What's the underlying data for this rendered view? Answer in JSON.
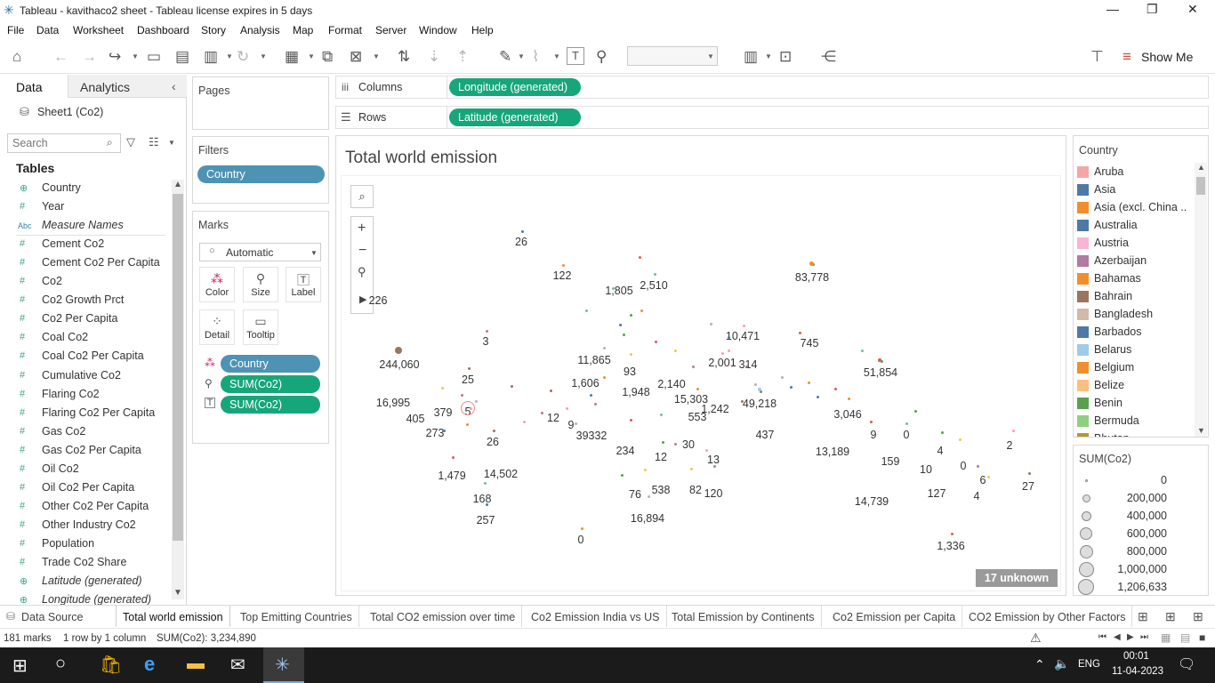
{
  "window": {
    "title": "Tableau - kavithaco2 sheet - Tableau license expires in 5 days"
  },
  "menu": [
    "File",
    "Data",
    "Worksheet",
    "Dashboard",
    "Story",
    "Analysis",
    "Map",
    "Format",
    "Server",
    "Window",
    "Help"
  ],
  "toolbar": {
    "show_me": "Show Me"
  },
  "data_pane": {
    "tab_data": "Data",
    "tab_analytics": "Analytics",
    "datasource": "Sheet1 (Co2)",
    "search_placeholder": "Search",
    "tables_header": "Tables",
    "fields": [
      {
        "icon": "globe-icon",
        "glyph": "⊕",
        "name": "Country",
        "italic": false
      },
      {
        "icon": "number-icon",
        "glyph": "#",
        "name": "Year",
        "italic": false
      },
      {
        "icon": "text-icon",
        "glyph": "Abc",
        "name": "Measure Names",
        "italic": true
      },
      {
        "icon": "number-icon",
        "glyph": "#",
        "name": "Cement Co2",
        "italic": false
      },
      {
        "icon": "number-icon",
        "glyph": "#",
        "name": "Cement Co2 Per Capita",
        "italic": false
      },
      {
        "icon": "number-icon",
        "glyph": "#",
        "name": "Co2",
        "italic": false
      },
      {
        "icon": "number-icon",
        "glyph": "#",
        "name": "Co2 Growth Prct",
        "italic": false
      },
      {
        "icon": "number-icon",
        "glyph": "#",
        "name": "Co2 Per Capita",
        "italic": false
      },
      {
        "icon": "number-icon",
        "glyph": "#",
        "name": "Coal Co2",
        "italic": false
      },
      {
        "icon": "number-icon",
        "glyph": "#",
        "name": "Coal Co2 Per Capita",
        "italic": false
      },
      {
        "icon": "number-icon",
        "glyph": "#",
        "name": "Cumulative Co2",
        "italic": false
      },
      {
        "icon": "number-icon",
        "glyph": "#",
        "name": "Flaring Co2",
        "italic": false
      },
      {
        "icon": "number-icon",
        "glyph": "#",
        "name": "Flaring Co2 Per Capita",
        "italic": false
      },
      {
        "icon": "number-icon",
        "glyph": "#",
        "name": "Gas Co2",
        "italic": false
      },
      {
        "icon": "number-icon",
        "glyph": "#",
        "name": "Gas Co2 Per Capita",
        "italic": false
      },
      {
        "icon": "number-icon",
        "glyph": "#",
        "name": "Oil Co2",
        "italic": false
      },
      {
        "icon": "number-icon",
        "glyph": "#",
        "name": "Oil Co2 Per Capita",
        "italic": false
      },
      {
        "icon": "number-icon",
        "glyph": "#",
        "name": "Other Co2 Per Capita",
        "italic": false
      },
      {
        "icon": "number-icon",
        "glyph": "#",
        "name": "Other Industry Co2",
        "italic": false
      },
      {
        "icon": "number-icon",
        "glyph": "#",
        "name": "Population",
        "italic": false
      },
      {
        "icon": "number-icon",
        "glyph": "#",
        "name": "Trade Co2 Share",
        "italic": false
      },
      {
        "icon": "globe-icon",
        "glyph": "⊕",
        "name": "Latitude (generated)",
        "italic": true
      },
      {
        "icon": "globe-icon",
        "glyph": "⊕",
        "name": "Longitude (generated)",
        "italic": true
      }
    ]
  },
  "cards": {
    "pages": "Pages",
    "filters": "Filters",
    "filter_pill": "Country",
    "marks": "Marks",
    "mark_type": "Automatic",
    "mark_buttons": [
      "Color",
      "Size",
      "Label",
      "Detail",
      "Tooltip"
    ],
    "mark_pills": [
      "Country",
      "SUM(Co2)",
      "SUM(Co2)"
    ]
  },
  "shelves": {
    "columns_label": "Columns",
    "columns_pill": "Longitude (generated)",
    "rows_label": "Rows",
    "rows_pill": "Latitude (generated)"
  },
  "viz": {
    "title": "Total world emission",
    "unknown_badge": "17 unknown",
    "labels": [
      "26",
      "122",
      "1,805",
      "2,510",
      "83,778",
      "226",
      "3",
      "10,471",
      "745",
      "244,060",
      "11,865",
      "2,001",
      "314",
      "51,854",
      "93",
      "25",
      "1,606",
      "1,948",
      "2,140",
      "16,995",
      "15,303",
      "49,218",
      "379",
      "5",
      "1,242",
      "3,046",
      "405",
      "12",
      "553",
      "273",
      "9",
      "39332",
      "437",
      "9",
      "0",
      "26",
      "30",
      "4",
      "234",
      "13,189",
      "12",
      "13",
      "159",
      "2",
      "0",
      "10",
      "1,479",
      "14,502",
      "76",
      "538",
      "82",
      "120",
      "127",
      "6",
      "168",
      "14,739",
      "4",
      "27",
      "16,894",
      "257",
      "0",
      "1,336"
    ]
  },
  "legend_country": {
    "title": "Country",
    "items": [
      {
        "name": "Aruba",
        "color": "#f4a6a6"
      },
      {
        "name": "Asia",
        "color": "#4e79a7"
      },
      {
        "name": "Asia (excl. China ..",
        "color": "#f28e2b"
      },
      {
        "name": "Australia",
        "color": "#4e79a7"
      },
      {
        "name": "Austria",
        "color": "#f7b6d2"
      },
      {
        "name": "Azerbaijan",
        "color": "#b07aa1"
      },
      {
        "name": "Bahamas",
        "color": "#f28e2b"
      },
      {
        "name": "Bahrain",
        "color": "#9c755f"
      },
      {
        "name": "Bangladesh",
        "color": "#d4b8a8"
      },
      {
        "name": "Barbados",
        "color": "#4e79a7"
      },
      {
        "name": "Belarus",
        "color": "#a0cbe8"
      },
      {
        "name": "Belgium",
        "color": "#f28e2b"
      },
      {
        "name": "Belize",
        "color": "#ffbe7d"
      },
      {
        "name": "Benin",
        "color": "#59a14f"
      },
      {
        "name": "Bermuda",
        "color": "#8cd17d"
      },
      {
        "name": "Bhutan",
        "color": "#b6992d"
      }
    ]
  },
  "legend_size": {
    "title": "SUM(Co2)",
    "items": [
      "0",
      "200,000",
      "400,000",
      "600,000",
      "800,000",
      "1,000,000",
      "1,206,633"
    ]
  },
  "sheet_tabs": [
    "Data Source",
    "Total world emission",
    "Top Emitting Countries",
    "Total CO2 emission over time",
    "Co2 Emission India vs US",
    "Total Emission by Continents",
    "Co2 Emission per Capita",
    "CO2 Emission by Other Factors"
  ],
  "status": {
    "marks": "181 marks",
    "rows": "1 row by 1 column",
    "sum": "SUM(Co2): 3,234,890"
  },
  "taskbar": {
    "lang": "ENG",
    "time": "00:01",
    "date": "11-04-2023"
  }
}
